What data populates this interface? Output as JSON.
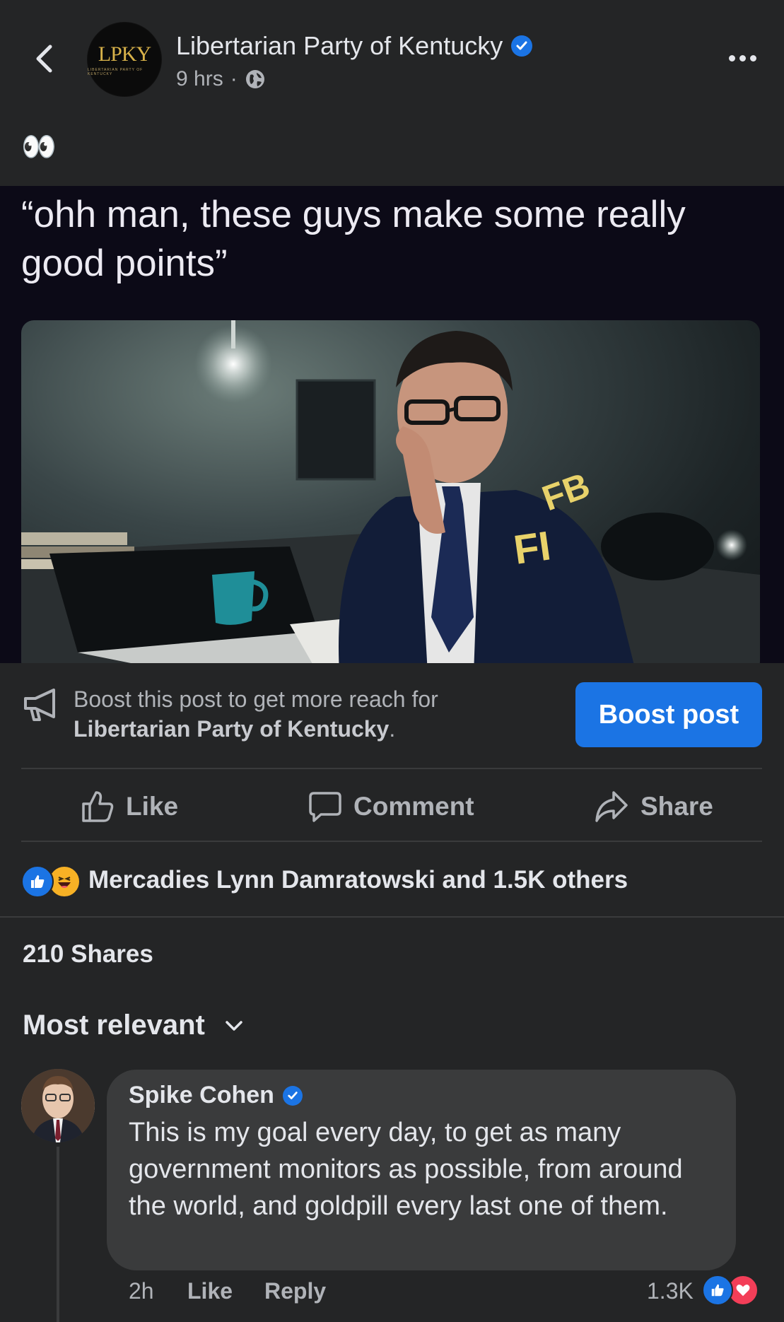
{
  "header": {
    "page_name": "Libertarian Party of Kentucky",
    "time": "9 hrs",
    "separator": "·",
    "avatar_logo": "LPKY",
    "avatar_subtext": "LIBERTARIAN PARTY OF KENTUCKY",
    "icons": {
      "back": "chevron-left-icon",
      "audience": "globe-icon",
      "more": "more-dots-icon",
      "verified": "verified-badge-icon"
    }
  },
  "post": {
    "text": "👀",
    "media_caption": "“ohh man, these guys make some really good points”",
    "image_badge_text": "FBI"
  },
  "boost": {
    "line1": "Boost this post to get more reach for",
    "page_name": "Libertarian Party of Kentucky",
    "period": ".",
    "button_label": "Boost post"
  },
  "actions": {
    "like_label": "Like",
    "comment_label": "Comment",
    "share_label": "Share"
  },
  "engagement": {
    "reactors_text": "Mercadies Lynn Damratowski and 1.5K others",
    "shares_text": "210 Shares",
    "sort_label": "Most relevant"
  },
  "comment": {
    "author": "Spike Cohen",
    "text": "This is my goal every day, to get as many government monitors as possible, from around the world, and goldpill every last one of them.",
    "time": "2h",
    "like_label": "Like",
    "reply_label": "Reply",
    "reaction_count": "1.3K"
  },
  "colors": {
    "background": "#242526",
    "bubble": "#3a3b3c",
    "accent": "#1b74e4",
    "text_primary": "#e4e6eb",
    "text_secondary": "#b0b3b8",
    "love": "#f33e58",
    "haha": "#f7b125"
  }
}
